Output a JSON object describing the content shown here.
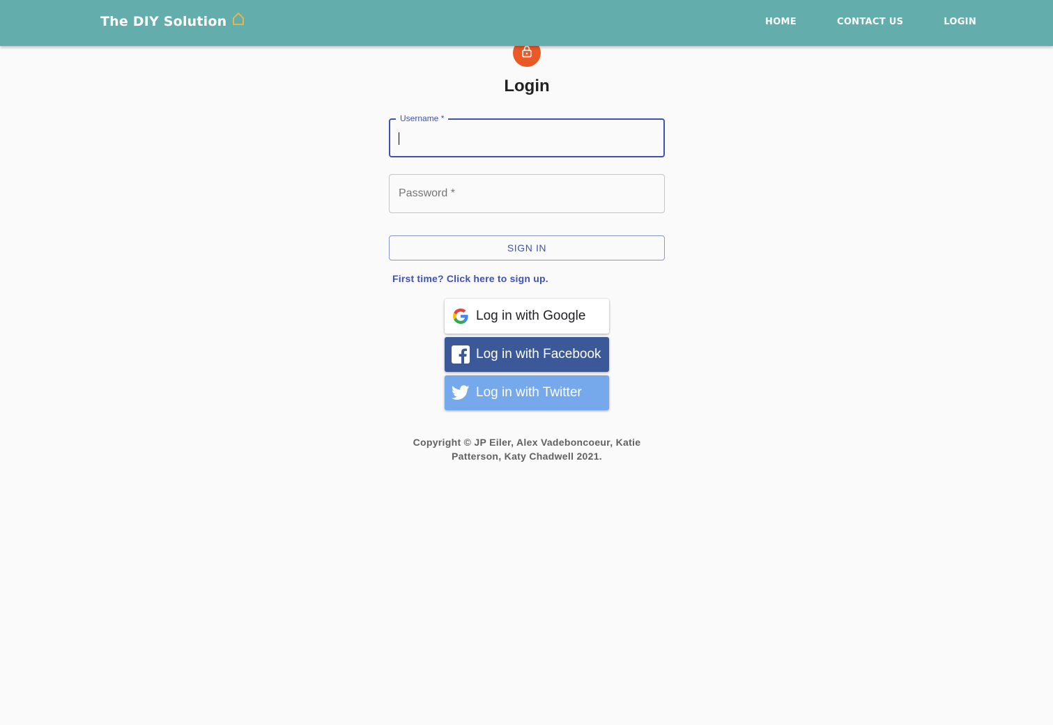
{
  "navbar": {
    "brand": "The DIY Solution",
    "links": [
      "Home",
      "Contact us",
      "Login"
    ]
  },
  "login": {
    "title": "Login",
    "username_label": "Username *",
    "password_label": "Password *",
    "signin_label": "Sign in",
    "signup_link": "First time? Click here to sign up."
  },
  "social": {
    "google": "Log in with Google",
    "facebook": "Log in with Facebook",
    "twitter": "Log in with Twitter"
  },
  "footer": {
    "copyright": "Copyright ©  JP Eiler, Alex Vadeboncoeur, Katie Patterson, Katy Chadwell  2021."
  },
  "colors": {
    "navbar": "#63adac",
    "brand_icon": "#f0b93e",
    "lock_avatar": "#ea5a27",
    "primary": "#3f51b5",
    "facebook": "#3b5998",
    "twitter": "#76a8ec"
  },
  "icons": {
    "brand": "home-icon",
    "avatar": "lock-icon",
    "google": "google-icon",
    "facebook": "facebook-icon",
    "twitter": "twitter-icon"
  }
}
